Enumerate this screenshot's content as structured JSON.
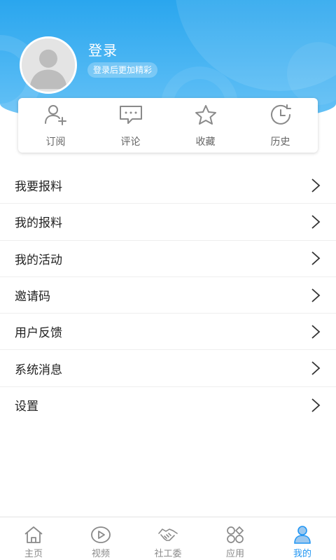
{
  "header": {
    "login_title": "登录",
    "login_hint": "登录后更加精彩",
    "avatar_icon": "default-avatar-icon"
  },
  "actions": [
    {
      "label": "订阅",
      "icon": "subscribe-icon"
    },
    {
      "label": "评论",
      "icon": "comment-icon"
    },
    {
      "label": "收藏",
      "icon": "star-icon"
    },
    {
      "label": "历史",
      "icon": "history-icon"
    }
  ],
  "menu": [
    {
      "label": "我要报料"
    },
    {
      "label": "我的报料"
    },
    {
      "label": "我的活动"
    },
    {
      "label": "邀请码"
    },
    {
      "label": "用户反馈"
    },
    {
      "label": "系统消息"
    },
    {
      "label": "设置"
    }
  ],
  "tabs": [
    {
      "label": "主页",
      "icon": "home-icon",
      "active": false
    },
    {
      "label": "视频",
      "icon": "video-icon",
      "active": false
    },
    {
      "label": "社工委",
      "icon": "handshake-icon",
      "active": false
    },
    {
      "label": "应用",
      "icon": "apps-icon",
      "active": false
    },
    {
      "label": "我的",
      "icon": "user-icon",
      "active": true
    }
  ],
  "colors": {
    "header_blue": "#2aa6ee",
    "accent": "#2196f3",
    "icon_gray": "#8a8a8a"
  }
}
